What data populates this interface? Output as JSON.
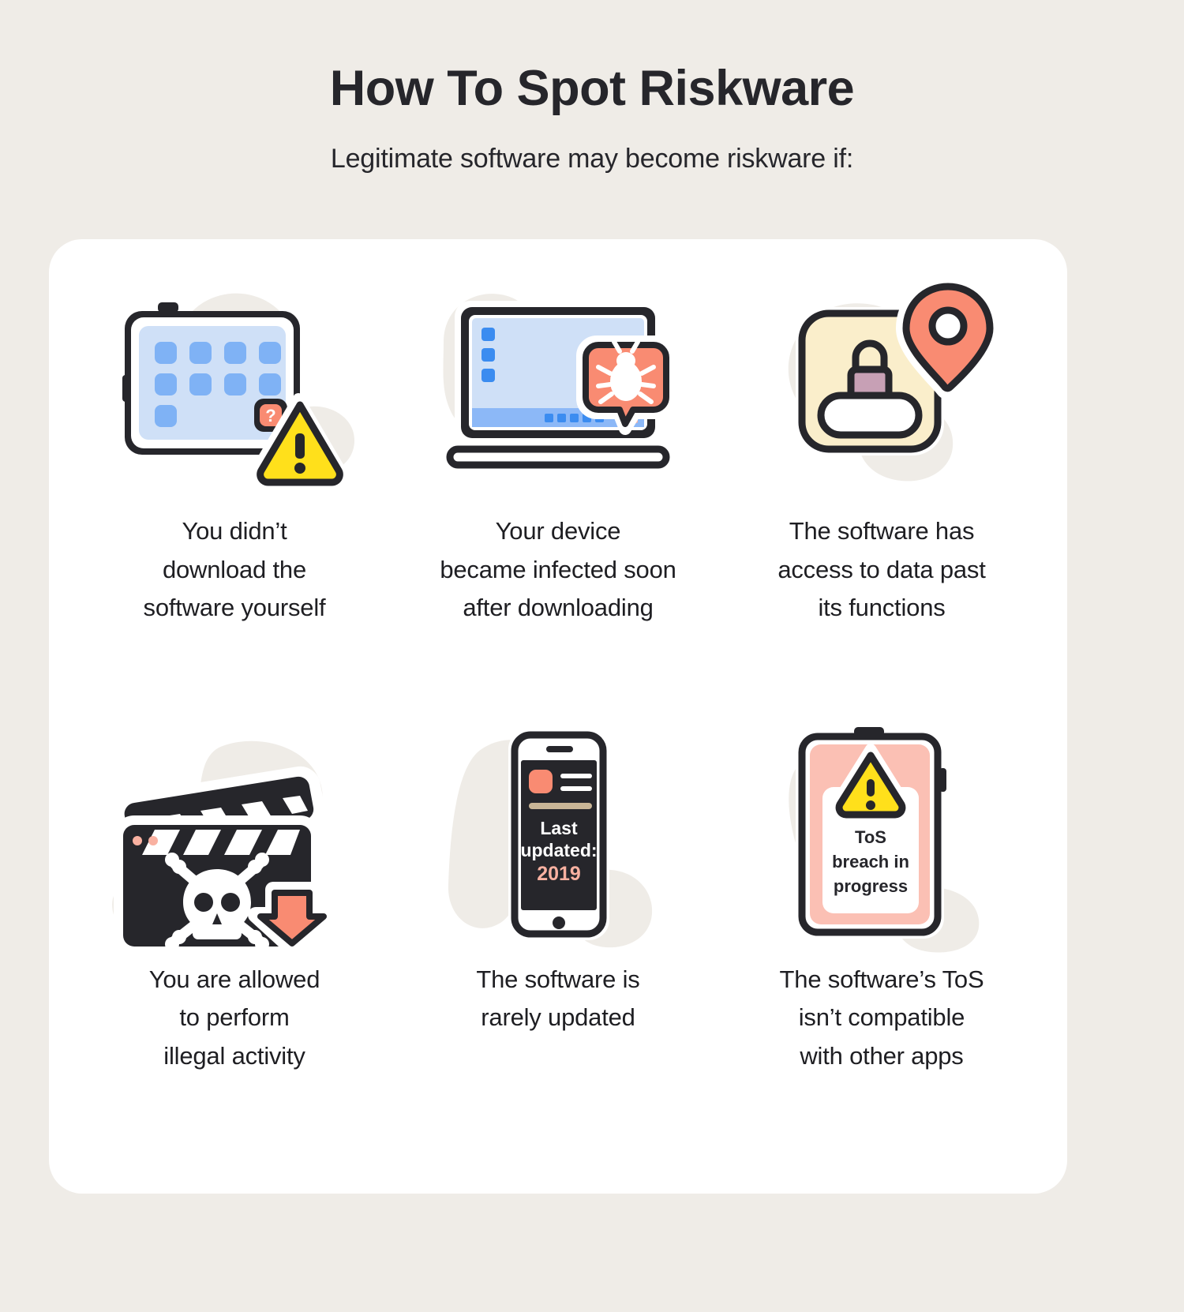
{
  "header": {
    "title": "How To Spot Riskware",
    "subtitle": "Legitimate software may become riskware if:"
  },
  "colors": {
    "page_background": "#efece7",
    "card_background": "#ffffff",
    "text": "#1e1e22",
    "ink": "#26262b",
    "blue_screen": "#cfe0f7",
    "blue_tile": "#7fb2f5",
    "blue_accent": "#3b8cf0",
    "blue_taskbar": "#8cb8f7",
    "salmon": "#f98b72",
    "salmon_light": "#f9b1a1",
    "salmon_pale": "#fbc0b4",
    "yellow": "#ffe01b",
    "cream": "#faeecb",
    "mauve": "#c7a0b5",
    "tan": "#c9b596",
    "dark": "#26262b",
    "white": "#ffffff"
  },
  "items": [
    {
      "id": "tablet-unknown-app",
      "icon": "tablet-app-grid-warning-icon",
      "caption": "You didn’t download the software yourself",
      "caption_lines": [
        "You didn’t",
        "download the",
        "software yourself"
      ],
      "art": {
        "app_badge_label": "?",
        "tile_rows": 3,
        "tile_cols": 4,
        "warning_glyph": "!"
      }
    },
    {
      "id": "laptop-infected",
      "icon": "laptop-bug-alert-icon",
      "caption": "Your device became infected soon after downloading",
      "caption_lines": [
        "Your device",
        "became infected soon",
        "after downloading"
      ],
      "art": {
        "sidebar_items": 3,
        "taskbar_dots": 5,
        "bubble_icon": "bug-icon"
      }
    },
    {
      "id": "password-location-access",
      "icon": "password-lock-location-pin-icon",
      "caption": "The software has access to data past its functions",
      "caption_lines": [
        "The software has",
        "access to data past",
        "its functions"
      ],
      "art": {
        "password_mask": "✱✱✱",
        "pin_icon": "location-pin-icon",
        "lock_icon": "padlock-icon"
      }
    },
    {
      "id": "illegal-activity",
      "icon": "clapperboard-skull-download-icon",
      "caption": "You are allowed to perform illegal activity",
      "caption_lines": [
        "You are allowed",
        "to perform",
        "illegal activity"
      ],
      "art": {
        "skull_icon": "skull-crossbones-icon",
        "download_icon": "download-arrow-icon",
        "stripe_count": 4
      }
    },
    {
      "id": "rarely-updated",
      "icon": "phone-last-updated-icon",
      "caption": "The software is rarely updated",
      "caption_lines": [
        "The software is",
        "rarely updated"
      ],
      "art": {
        "screen_lines": [
          "Last",
          "updated:"
        ],
        "screen_year": "2019"
      }
    },
    {
      "id": "tos-incompatible",
      "icon": "tablet-tos-breach-alert-icon",
      "caption": "The software’s ToS isn’t compatible with other apps",
      "caption_lines": [
        "The software’s ToS",
        "isn’t compatible",
        "with other apps"
      ],
      "art": {
        "dialog_lines": [
          "ToS",
          "breach in",
          "progress"
        ],
        "warning_glyph": "!"
      }
    }
  ]
}
